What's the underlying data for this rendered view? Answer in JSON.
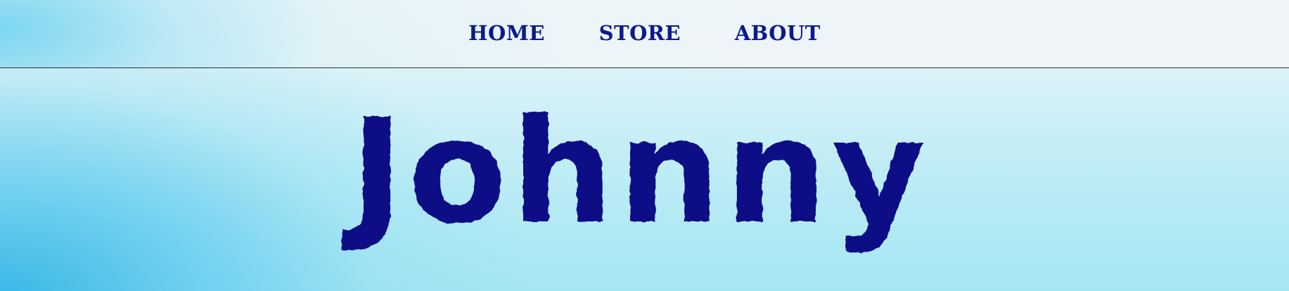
{
  "nav": {
    "items": [
      {
        "label": "HOME"
      },
      {
        "label": "STORE"
      },
      {
        "label": "ABOUT"
      }
    ]
  },
  "hero": {
    "title": "Johnny"
  },
  "colors": {
    "nav_text": "#0b1a8c",
    "title_text": "#0a0f86",
    "divider": "#2a2f33",
    "background_light": "#eef6f9",
    "background_blue": "#32b4e6"
  }
}
